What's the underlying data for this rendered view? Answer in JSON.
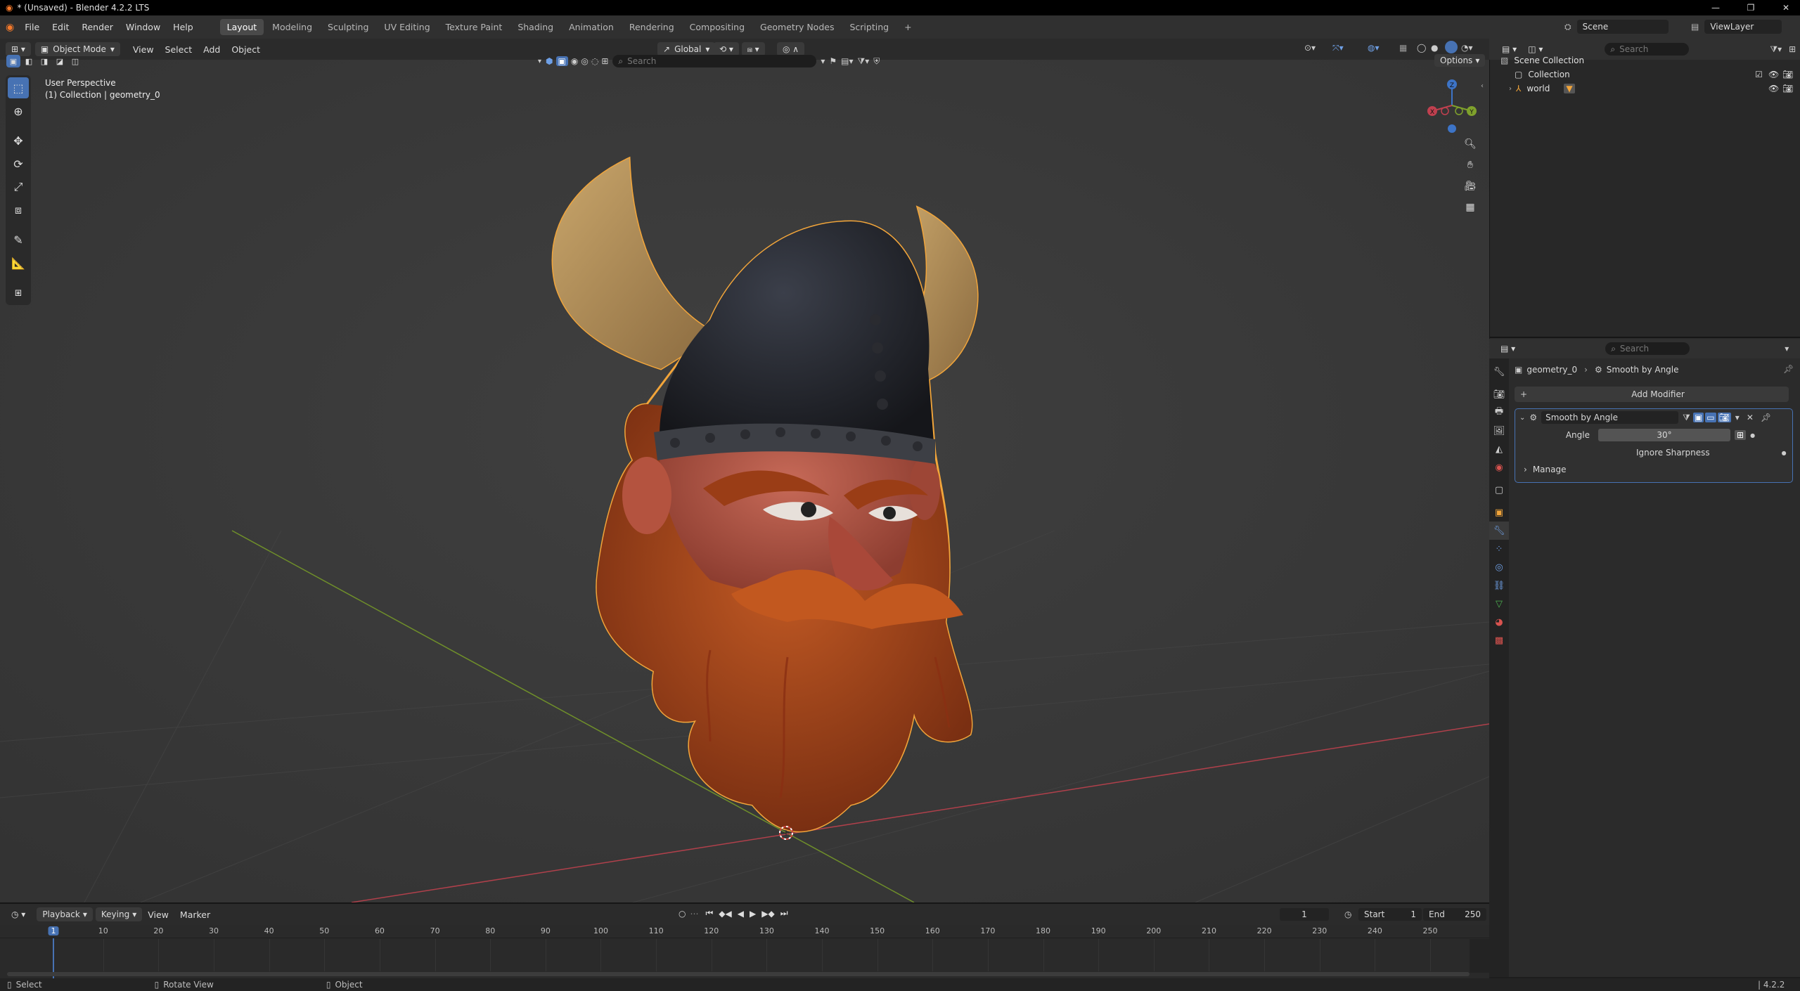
{
  "window": {
    "title": "* (Unsaved) - Blender 4.2.2 LTS"
  },
  "menu": {
    "items": [
      "File",
      "Edit",
      "Render",
      "Window",
      "Help"
    ]
  },
  "workspaces": {
    "active": "Layout",
    "tabs": [
      "Layout",
      "Modeling",
      "Sculpting",
      "UV Editing",
      "Texture Paint",
      "Shading",
      "Animation",
      "Rendering",
      "Compositing",
      "Geometry Nodes",
      "Scripting"
    ]
  },
  "scene": {
    "name": "Scene",
    "view_layer": "ViewLayer"
  },
  "viewport": {
    "mode": "Object Mode",
    "menus": [
      "View",
      "Select",
      "Add",
      "Object"
    ],
    "transform_orientation": "Global",
    "search_placeholder": "Search",
    "options_label": "Options",
    "perspective_label": "User Perspective",
    "collection_label": "(1) Collection | geometry_0",
    "gizmo": {
      "z": "Z",
      "x": "X",
      "y": "Y"
    }
  },
  "outliner": {
    "search_placeholder": "Search",
    "rows": [
      {
        "label": "Scene Collection"
      },
      {
        "label": "Collection"
      },
      {
        "label": "world"
      }
    ]
  },
  "properties": {
    "search_placeholder": "Search",
    "breadcrumb_object": "geometry_0",
    "breadcrumb_modifier": "Smooth by Angle",
    "add_modifier_label": "Add Modifier",
    "modifier": {
      "name": "Smooth by Angle",
      "angle_label": "Angle",
      "angle_value": "30°",
      "ignore_sharpness_label": "Ignore Sharpness",
      "manage_label": "Manage"
    }
  },
  "timeline": {
    "menus": [
      "Playback",
      "Keying",
      "View",
      "Marker"
    ],
    "current_frame": "1",
    "start_label": "Start",
    "start": "1",
    "end_label": "End",
    "end": "250",
    "ticks": [
      "1",
      "10",
      "20",
      "30",
      "40",
      "50",
      "60",
      "70",
      "80",
      "90",
      "100",
      "110",
      "120",
      "130",
      "140",
      "150",
      "160",
      "170",
      "180",
      "190",
      "200",
      "210",
      "220",
      "230",
      "240",
      "250"
    ]
  },
  "statusbar": {
    "left": "Select",
    "middle": "Rotate View",
    "right": "Object",
    "version": "4.2.2"
  },
  "colors": {
    "accent": "#4772b3",
    "selection_outline": "#f2a53a",
    "x_axis": "#c0404f",
    "y_axis": "#7fa12c",
    "z_axis": "#3d74c7"
  }
}
